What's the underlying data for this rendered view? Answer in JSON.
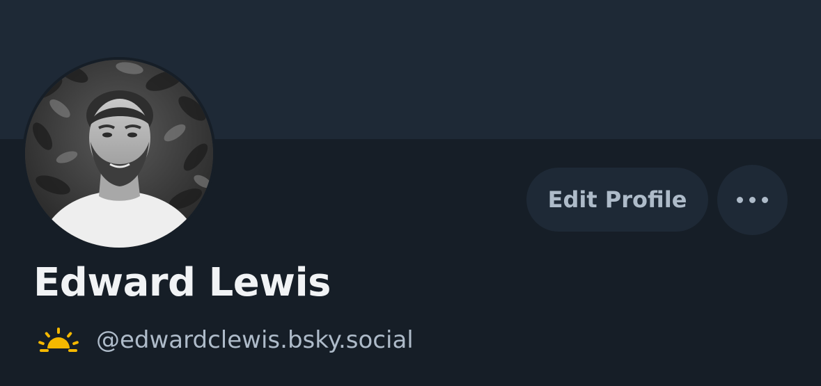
{
  "profile": {
    "display_name": "Edward Lewis",
    "handle": "@edwardclewis.bsky.social",
    "handle_emoji_icon": "sunrise-icon"
  },
  "actions": {
    "edit_profile_label": "Edit Profile",
    "more_icon": "ellipsis-icon"
  },
  "colors": {
    "banner": "#1e2936",
    "background": "#161e27",
    "button_background": "#1e2936",
    "button_text": "#aebbc9",
    "name_text": "#f1f3f5",
    "handle_text": "#aebbc9",
    "sun_accent": "#f5b800"
  }
}
